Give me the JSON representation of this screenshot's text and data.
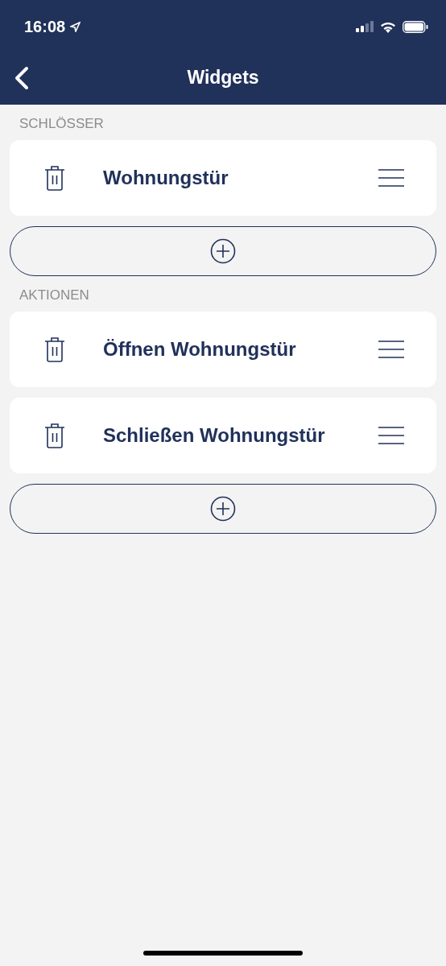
{
  "status_bar": {
    "time": "16:08"
  },
  "header": {
    "title": "Widgets"
  },
  "sections": [
    {
      "label": "SCHLÖSSER",
      "items": [
        {
          "name": "Wohnungstür"
        }
      ]
    },
    {
      "label": "AKTIONEN",
      "items": [
        {
          "name": "Öffnen Wohnungstür"
        },
        {
          "name": "Schließen Wohnungstür"
        }
      ]
    }
  ]
}
